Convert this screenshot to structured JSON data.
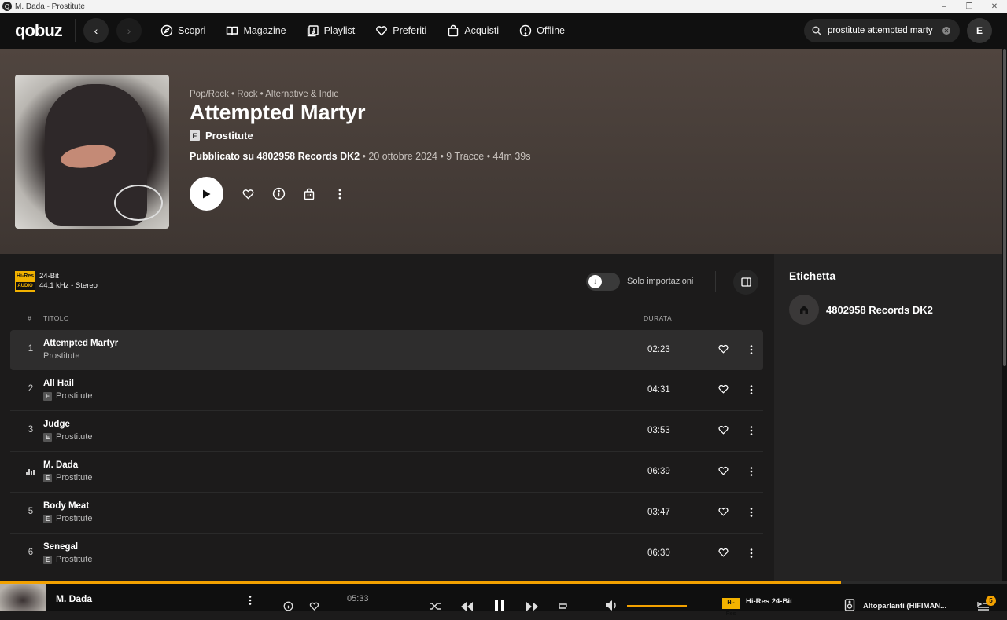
{
  "window": {
    "title": "M. Dada - Prostitute",
    "min": "–",
    "max": "❐",
    "close": "✕"
  },
  "nav": {
    "logo": "qobuz",
    "back": "‹",
    "forward": "›",
    "items": [
      {
        "label": "Scopri",
        "icon": "compass-icon"
      },
      {
        "label": "Magazine",
        "icon": "book-icon"
      },
      {
        "label": "Playlist",
        "icon": "playlist-icon"
      },
      {
        "label": "Preferiti",
        "icon": "heart-icon"
      },
      {
        "label": "Acquisti",
        "icon": "bag-icon"
      },
      {
        "label": "Offline",
        "icon": "offline-icon"
      }
    ],
    "search_value": "prostitute attempted marty",
    "avatar_initial": "E"
  },
  "album": {
    "genres": "Pop/Rock • Rock • Alternative & Indie",
    "title": "Attempted Martyr",
    "explicit": "E",
    "artist": "Prostitute",
    "published_prefix": "Pubblicato su",
    "label": "4802958 Records DK2",
    "details": " • 20 ottobre 2024 • 9 Tracce • 44m 39s"
  },
  "quality": {
    "badge_top": "Hi-Res",
    "badge_bottom": "AUDIO",
    "bit": "24-Bit",
    "rate": "44.1 kHz - Stereo"
  },
  "toggle": {
    "label": "Solo importazioni",
    "icon": "↓"
  },
  "table": {
    "col_num": "#",
    "col_title": "TITOLO",
    "col_duration": "DURATA",
    "tracks": [
      {
        "num": "1",
        "title": "Attempted Martyr",
        "artist": "Prostitute",
        "explicit": "",
        "duration": "02:23"
      },
      {
        "num": "2",
        "title": "All Hail",
        "artist": "Prostitute",
        "explicit": "E",
        "duration": "04:31"
      },
      {
        "num": "3",
        "title": "Judge",
        "artist": "Prostitute",
        "explicit": "E",
        "duration": "03:53"
      },
      {
        "num": "",
        "title": "M. Dada",
        "artist": "Prostitute",
        "explicit": "E",
        "duration": "06:39"
      },
      {
        "num": "5",
        "title": "Body Meat",
        "artist": "Prostitute",
        "explicit": "E",
        "duration": "03:47"
      },
      {
        "num": "6",
        "title": "Senegal",
        "artist": "Prostitute",
        "explicit": "E",
        "duration": "06:30"
      }
    ]
  },
  "side": {
    "title": "Etichetta",
    "label_name": "4802958 Records DK2"
  },
  "player": {
    "track_title": "M. Dada",
    "elapsed": "05:33",
    "progress": 0.835,
    "volume": 1.0,
    "quality_badge": "Hi-Res",
    "quality_text": "Hi-Res 24-Bit",
    "device": "Altoparlanti (HIFIMAN...",
    "queue_count": "5"
  },
  "colors": {
    "accent": "#f2a100",
    "hero_bg": "#50453f",
    "background": "#1c1b1b"
  }
}
